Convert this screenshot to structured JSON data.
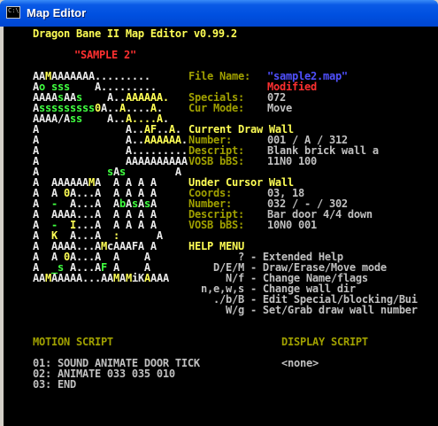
{
  "window": {
    "title": "Map Editor",
    "icon": "console-icon",
    "icon_text": "C:\\"
  },
  "header": "Dragon Bane II Map Editor v0.99.2",
  "map_name": "\"SAMPLE 2\"",
  "map_rows": [
    [
      {
        "t": "AA",
        "c": "w"
      },
      {
        "t": "M",
        "c": "y"
      },
      {
        "t": "AAAAAAA.........",
        "c": "w"
      }
    ],
    [
      {
        "t": "A",
        "c": "w"
      },
      {
        "t": "o sss",
        "c": "lg"
      },
      {
        "t": "    A.........",
        "c": "w"
      }
    ],
    [
      {
        "t": "AAAA",
        "c": "w"
      },
      {
        "t": "s",
        "c": "lg"
      },
      {
        "t": "AA",
        "c": "w"
      },
      {
        "t": "s",
        "c": "lg"
      },
      {
        "t": "    A..",
        "c": "w"
      },
      {
        "t": "AAAAAA.",
        "c": "y"
      }
    ],
    [
      {
        "t": "A",
        "c": "w"
      },
      {
        "t": "sssssssss",
        "c": "lg"
      },
      {
        "t": "0",
        "c": "y"
      },
      {
        "t": "A..",
        "c": "w"
      },
      {
        "t": "A",
        "c": "y"
      },
      {
        "t": "....",
        "c": "w"
      },
      {
        "t": "A",
        "c": "y"
      },
      {
        "t": ".",
        "c": "w"
      }
    ],
    [
      {
        "t": "AAAA/A",
        "c": "w"
      },
      {
        "t": "ss",
        "c": "lg"
      },
      {
        "t": "    A..",
        "c": "w"
      },
      {
        "t": "A....A",
        "c": "y"
      },
      {
        "t": ".",
        "c": "w"
      }
    ],
    [
      {
        "t": "A              A..",
        "c": "w"
      },
      {
        "t": "AF",
        "c": "y"
      },
      {
        "t": "..",
        "c": "w"
      },
      {
        "t": "A",
        "c": "y"
      },
      {
        "t": ".",
        "c": "w"
      }
    ],
    [
      {
        "t": "A              A..",
        "c": "w"
      },
      {
        "t": "AAAAAA",
        "c": "y"
      },
      {
        "t": ".",
        "c": "w"
      }
    ],
    [
      {
        "t": "A              A.........",
        "c": "w"
      }
    ],
    [
      {
        "t": "A              AAAAAAAAAA",
        "c": "w"
      }
    ],
    [
      {
        "t": "A           ",
        "c": "w"
      },
      {
        "t": "s",
        "c": "lg"
      },
      {
        "t": "A",
        "c": "w"
      },
      {
        "t": "s",
        "c": "lg"
      },
      {
        "t": "        A",
        "c": "w"
      }
    ],
    [
      {
        "t": "A  AAAAAA",
        "c": "w"
      },
      {
        "t": "M",
        "c": "y"
      },
      {
        "t": "A  A A A A",
        "c": "w"
      }
    ],
    [
      {
        "t": "A  A ",
        "c": "w"
      },
      {
        "t": "0",
        "c": "y"
      },
      {
        "t": "A...A  A A A A",
        "c": "w"
      }
    ],
    [
      {
        "t": "A  ",
        "c": "w"
      },
      {
        "t": "-",
        "c": "lg"
      },
      {
        "t": "  A...A  A",
        "c": "w"
      },
      {
        "t": "b",
        "c": "lg"
      },
      {
        "t": "A",
        "c": "w"
      },
      {
        "t": "s",
        "c": "lg"
      },
      {
        "t": "A",
        "c": "w"
      },
      {
        "t": "s",
        "c": "lg"
      },
      {
        "t": "A",
        "c": "w"
      }
    ],
    [
      {
        "t": "A  AAAA...A  A A A A",
        "c": "w"
      }
    ],
    [
      {
        "t": "A  ",
        "c": "w"
      },
      {
        "t": "-",
        "c": "lg"
      },
      {
        "t": "  ",
        "c": "w"
      },
      {
        "t": "I",
        "c": "y"
      },
      {
        "t": "...A  A A A A",
        "c": "w"
      }
    ],
    [
      {
        "t": "A  ",
        "c": "w"
      },
      {
        "t": "K",
        "c": "y"
      },
      {
        "t": "  A...A  ",
        "c": "w"
      },
      {
        "t": ":",
        "c": "y"
      },
      {
        "t": "      A",
        "c": "w"
      }
    ],
    [
      {
        "t": "A  AAAA...A",
        "c": "w"
      },
      {
        "t": "M",
        "c": "y"
      },
      {
        "t": "cAAAFA A",
        "c": "w"
      }
    ],
    [
      {
        "t": "A  A ",
        "c": "w"
      },
      {
        "t": "0",
        "c": "y"
      },
      {
        "t": "A...A  A    A",
        "c": "w"
      }
    ],
    [
      {
        "t": "A  ",
        "c": "w"
      },
      {
        "t": "_s",
        "c": "lg"
      },
      {
        "t": " A...A",
        "c": "w"
      },
      {
        "t": "F",
        "c": "lg"
      },
      {
        "t": " A    A",
        "c": "w"
      }
    ],
    [
      {
        "t": "AA",
        "c": "w"
      },
      {
        "t": "M",
        "c": "y"
      },
      {
        "t": "AAAAA...AA",
        "c": "w"
      },
      {
        "t": "M",
        "c": "y"
      },
      {
        "t": "A",
        "c": "w"
      },
      {
        "t": "M",
        "c": "y"
      },
      {
        "t": "iK",
        "c": "w"
      },
      {
        "t": "A",
        "c": "y"
      },
      {
        "t": "AAA",
        "c": "w"
      }
    ]
  ],
  "file_info": {
    "file_name_label": "File Name:",
    "file_name_value": "\"sample2.map\"",
    "modified": "Modified",
    "specials_label": "Specials:",
    "specials_value": "072",
    "cur_mode_label": "Cur Mode:",
    "cur_mode_value": "Move"
  },
  "current_draw_wall": {
    "heading": "Current Draw Wall",
    "rows": [
      {
        "label": "Number:",
        "value": "001 / A / 312"
      },
      {
        "label": "Descript:",
        "value": "Blank brick wall a"
      },
      {
        "label": "VOSB bBS:",
        "value": "11N0 100"
      }
    ]
  },
  "under_cursor_wall": {
    "heading": "Under Cursor Wall",
    "rows": [
      {
        "label": "Coords:",
        "value": "03, 18"
      },
      {
        "label": "Number:",
        "value": "032 / - / 302"
      },
      {
        "label": "Descript:",
        "value": "Bar door 4/4 down"
      },
      {
        "label": "VOSB bBS:",
        "value": "10N0 001"
      }
    ]
  },
  "help_menu": {
    "heading": "HELP MENU",
    "rows": [
      "        ? - Extended Help",
      "    D/E/M - Draw/Erase/Move mode",
      "      N/f - Change Name/flags",
      "  n,e,w,s - Change wall dir",
      "    ./b/B - Edit Special/blocking/Bui",
      "      W/g - Set/Grab draw wall number"
    ]
  },
  "motion_script": {
    "heading": "MOTION SCRIPT",
    "lines": [
      "01: SOUND ANIMATE DOOR TICK",
      "02: ANIMATE 033 035 010",
      "03: END"
    ]
  },
  "display_script": {
    "heading": "DISPLAY SCRIPT",
    "lines": [
      "<none>"
    ]
  }
}
